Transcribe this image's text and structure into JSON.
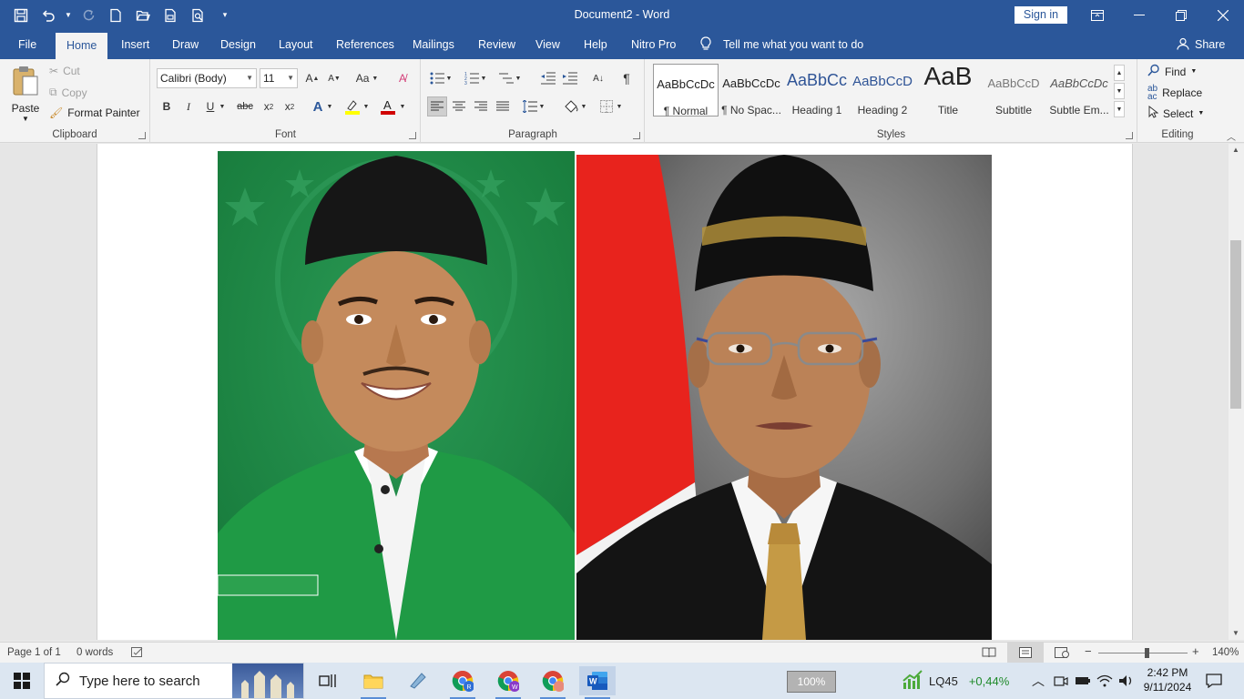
{
  "window": {
    "title": "Document2 - Word",
    "sign_in": "Sign in"
  },
  "tabs": [
    "File",
    "Home",
    "Insert",
    "Draw",
    "Design",
    "Layout",
    "References",
    "Mailings",
    "Review",
    "View",
    "Help",
    "Nitro Pro"
  ],
  "tell_me": "Tell me what you want to do",
  "share": "Share",
  "clipboard": {
    "paste": "Paste",
    "cut": "Cut",
    "copy": "Copy",
    "format_painter": "Format Painter",
    "label": "Clipboard"
  },
  "font": {
    "name": "Calibri (Body)",
    "size": "11",
    "label": "Font",
    "change_case": "Aa"
  },
  "paragraph": {
    "label": "Paragraph"
  },
  "styles": {
    "label": "Styles",
    "items": [
      {
        "preview": "AaBbCcDc",
        "name": "¶ Normal"
      },
      {
        "preview": "AaBbCcDc",
        "name": "¶ No Spac..."
      },
      {
        "preview": "AaBbCc",
        "name": "Heading 1"
      },
      {
        "preview": "AaBbCcD",
        "name": "Heading 2"
      },
      {
        "preview": "AaB",
        "name": "Title"
      },
      {
        "preview": "AaBbCcD",
        "name": "Subtitle"
      },
      {
        "preview": "AaBbCcDc",
        "name": "Subtle Em..."
      }
    ]
  },
  "editing": {
    "label": "Editing",
    "find": "Find",
    "replace": "Replace",
    "select": "Select"
  },
  "status": {
    "page": "Page 1 of 1",
    "words": "0 words",
    "zoom": "140%"
  },
  "taskbar": {
    "search_placeholder": "Type here to search",
    "display_zoom": "100%",
    "ticker_name": "LQ45",
    "ticker_change": "+0,44%",
    "time": "2:42 PM",
    "date": "9/11/2024"
  },
  "colors": {
    "accent": "#2b579a",
    "green_bg": "#1c8c46",
    "flag_red": "#e8231d"
  }
}
